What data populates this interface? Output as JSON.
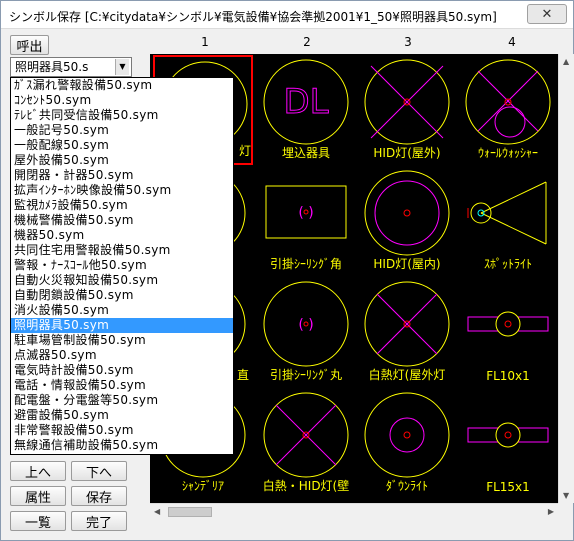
{
  "window": {
    "title": "シンボル保存 [C:¥citydata¥シンボル¥電気設備¥協会準拠2001¥1_50¥照明器具50.sym]",
    "close_label": "✕"
  },
  "left_panel": {
    "call_button": "呼出",
    "combo_value": "照明器具50.s",
    "buttons": {
      "up": "上へ",
      "down": "下へ",
      "attribute": "属性",
      "save": "保存",
      "list": "一覧",
      "done": "完了"
    }
  },
  "dropdown": {
    "items": [
      "ｶﾞｽ漏れ警報設備50.sym",
      "ｺﾝｾﾝﾄ50.sym",
      "ﾃﾚﾋﾞ共同受信設備50.sym",
      "一般記号50.sym",
      "一般配線50.sym",
      "屋外設備50.sym",
      "開閉器・計器50.sym",
      "拡声ｲﾝﾀｰﾎﾝ映像設備50.sym",
      "監視ｶﾒﾗ設備50.sym",
      "機械警備設備50.sym",
      "機器50.sym",
      "共同住宅用警報設備50.sym",
      "警報・ﾅｰｽｺｰﾙ他50.sym",
      "自動火災報知設備50.sym",
      "自動閉鎖設備50.sym",
      "消火設備50.sym",
      "照明器具50.sym",
      "駐車場管制設備50.sym",
      "点滅器50.sym",
      "電気時計設備50.sym",
      "電話・情報設備50.sym",
      "配電盤・分電盤等50.sym",
      "避雷設備50.sym",
      "非常警報設備50.sym",
      "無線通信補助設備50.sym"
    ],
    "selected_index": 16
  },
  "grid": {
    "column_headers": [
      "1",
      "2",
      "3",
      "4"
    ],
    "cells": [
      {
        "label": "灯"
      },
      {
        "label": "埋込器具"
      },
      {
        "label": "HID灯(屋外)"
      },
      {
        "label": "ｳｫｰﾙｳｫｯｼｬｰ"
      },
      {
        "label": ""
      },
      {
        "label": "引掛ｼｰﾘﾝｸﾞ角"
      },
      {
        "label": "HID灯(屋内)"
      },
      {
        "label": "ｽﾎﾟｯﾄﾗｲﾄ"
      },
      {
        "label": "直"
      },
      {
        "label": "引掛ｼｰﾘﾝｸﾞ丸"
      },
      {
        "label": "白熱灯(屋外灯"
      },
      {
        "label": "FL10x1"
      },
      {
        "label": "ｼｬﾝﾃﾞﾘｱ"
      },
      {
        "label": "白熱・HID灯(壁"
      },
      {
        "label": "ﾀﾞｳﾝﾗｲﾄ"
      },
      {
        "label": "FL15x1"
      }
    ],
    "dl_text": "DL",
    "paren_text": "(  )"
  },
  "colors": {
    "symbol_yellow": "#ffff00",
    "symbol_magenta": "#ff00ff",
    "symbol_red": "#ff0000",
    "symbol_cyan": "#00ffff",
    "selected_border": "#ff0000",
    "list_selection": "#3399ff"
  }
}
